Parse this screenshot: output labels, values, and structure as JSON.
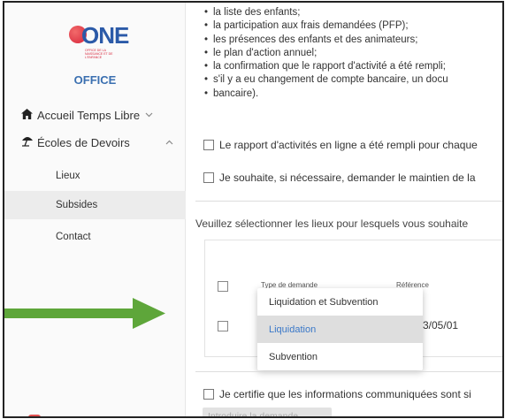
{
  "sidebar": {
    "logo_text": "ONE",
    "logo_subtext": "OFFICE DE LA NAISSANCE ET DE L'ENFANCE",
    "office_label": "OFFICE",
    "items": [
      {
        "label": "Accueil Temps Libre",
        "icon": "home-icon"
      },
      {
        "label": "Écoles de Devoirs",
        "icon": "beach-umbrella-icon"
      }
    ],
    "sub_items": [
      {
        "label": "Lieux"
      },
      {
        "label": "Subsides"
      },
      {
        "label": "Contact"
      }
    ]
  },
  "main": {
    "bullets": [
      "la liste des enfants;",
      "la participation aux frais demandées (PFP);",
      "les présences des enfants et des animateurs;",
      "le plan d'action annuel;",
      "la confirmation que le rapport d'activité a été rempli;",
      "s'il y a eu changement de compte bancaire, un docu",
      "bancaire)."
    ],
    "check1": "Le rapport d'activités en ligne a été rempli pour chaque",
    "check2": "Je souhaite, si nécessaire, demander le maintien de la",
    "section_prompt": "Veuillez sélectionner les lieux pour lesquels vous souhaite",
    "table": {
      "col_type": "Type de demande",
      "col_ref": "Référence",
      "row_ref": "3/05/01"
    },
    "dropdown_options": [
      "Liquidation et Subvention",
      "Liquidation",
      "Subvention"
    ],
    "selected_option": "Liquidation",
    "certify": "Je certifie que les informations communiquées sont si",
    "submit_label": "Introduire la demande"
  },
  "colors": {
    "brand_blue": "#3a6fb0",
    "arrow_green": "#5ea63a",
    "selected_text": "#3a78c8"
  }
}
